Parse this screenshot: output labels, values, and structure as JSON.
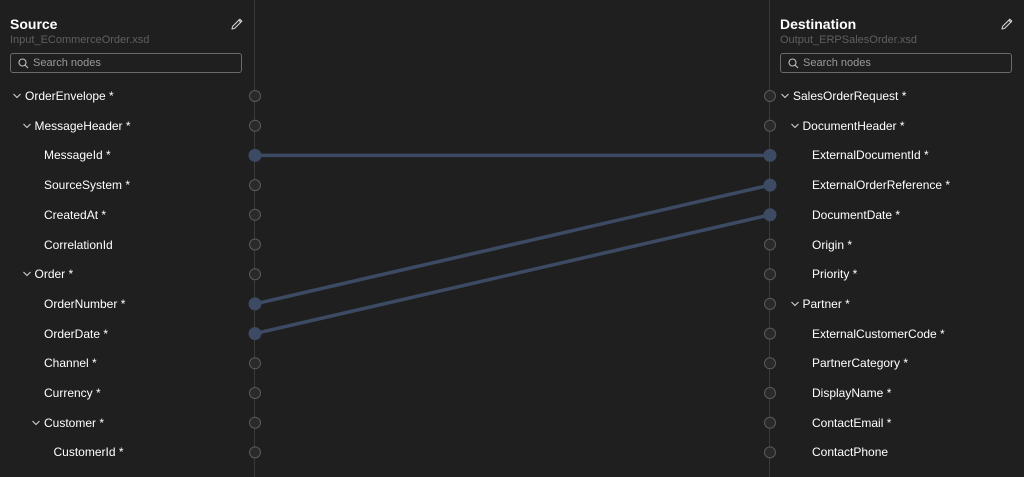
{
  "source": {
    "title": "Source",
    "file": "Input_ECommerceOrder.xsd",
    "search_placeholder": "Search nodes",
    "nodes": [
      {
        "label": "OrderEnvelope *",
        "level": 0,
        "expandable": true
      },
      {
        "label": "MessageHeader *",
        "level": 1,
        "expandable": true
      },
      {
        "label": "MessageId *",
        "level": 2,
        "expandable": false
      },
      {
        "label": "SourceSystem *",
        "level": 2,
        "expandable": false
      },
      {
        "label": "CreatedAt *",
        "level": 2,
        "expandable": false
      },
      {
        "label": "CorrelationId",
        "level": 2,
        "expandable": false
      },
      {
        "label": "Order *",
        "level": 1,
        "expandable": true
      },
      {
        "label": "OrderNumber *",
        "level": 2,
        "expandable": false
      },
      {
        "label": "OrderDate *",
        "level": 2,
        "expandable": false
      },
      {
        "label": "Channel *",
        "level": 2,
        "expandable": false
      },
      {
        "label": "Currency *",
        "level": 2,
        "expandable": false
      },
      {
        "label": "Customer *",
        "level": 2,
        "expandable": true
      },
      {
        "label": "CustomerId *",
        "level": 3,
        "expandable": false
      }
    ]
  },
  "destination": {
    "title": "Destination",
    "file": "Output_ERPSalesOrder.xsd",
    "search_placeholder": "Search nodes",
    "nodes": [
      {
        "label": "SalesOrderRequest *",
        "level": 0,
        "expandable": true
      },
      {
        "label": "DocumentHeader *",
        "level": 1,
        "expandable": true
      },
      {
        "label": "ExternalDocumentId *",
        "level": 2,
        "expandable": false
      },
      {
        "label": "ExternalOrderReference *",
        "level": 2,
        "expandable": false
      },
      {
        "label": "DocumentDate *",
        "level": 2,
        "expandable": false
      },
      {
        "label": "Origin *",
        "level": 2,
        "expandable": false
      },
      {
        "label": "Priority *",
        "level": 2,
        "expandable": false
      },
      {
        "label": "Partner *",
        "level": 1,
        "expandable": true
      },
      {
        "label": "ExternalCustomerCode *",
        "level": 2,
        "expandable": false
      },
      {
        "label": "PartnerCategory *",
        "level": 2,
        "expandable": false
      },
      {
        "label": "DisplayName *",
        "level": 2,
        "expandable": false
      },
      {
        "label": "ContactEmail *",
        "level": 2,
        "expandable": false
      },
      {
        "label": "ContactPhone",
        "level": 2,
        "expandable": false
      }
    ]
  },
  "mappings": [
    {
      "source": 2,
      "target": 2
    },
    {
      "source": 7,
      "target": 3
    },
    {
      "source": 8,
      "target": 4
    }
  ],
  "colors": {
    "background": "#1f1f1f",
    "link": "#3d4a63",
    "port_connected": "#3d4a63",
    "port_empty": "#2a2a2a",
    "port_border": "#5a5a5a"
  },
  "icons": {
    "edit": "pencil-icon",
    "search": "search-icon",
    "expand": "chevron-down-icon"
  }
}
